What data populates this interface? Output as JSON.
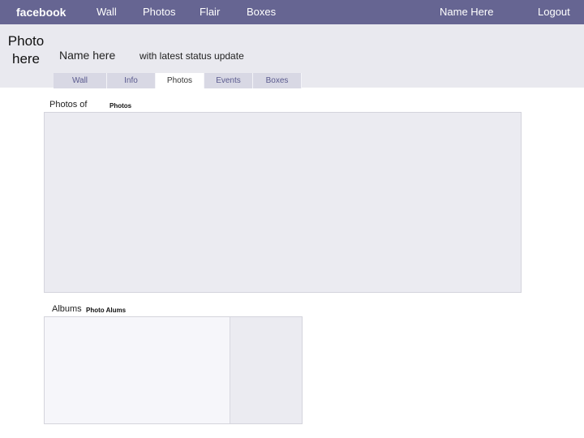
{
  "topbar": {
    "logo": "facebook",
    "nav": [
      "Wall",
      "Photos",
      "Flair",
      "Boxes"
    ],
    "user_name": "Name Here",
    "logout": "Logout"
  },
  "profile": {
    "photo_placeholder": "Photo here",
    "name": "Name here",
    "status": "with latest status update"
  },
  "tabs": [
    {
      "label": "Wall",
      "active": false
    },
    {
      "label": "Info",
      "active": false
    },
    {
      "label": "Photos",
      "active": true
    },
    {
      "label": "Events",
      "active": false
    },
    {
      "label": "Boxes",
      "active": false
    }
  ],
  "photos_section": {
    "label": "Photos of",
    "sublabel": "Photos"
  },
  "albums_section": {
    "label": "Albums",
    "sublabel": "Photo Alums"
  },
  "colors": {
    "topbar": "#666592",
    "band": "#e9e9ef",
    "tab": "#d8d8e4"
  }
}
